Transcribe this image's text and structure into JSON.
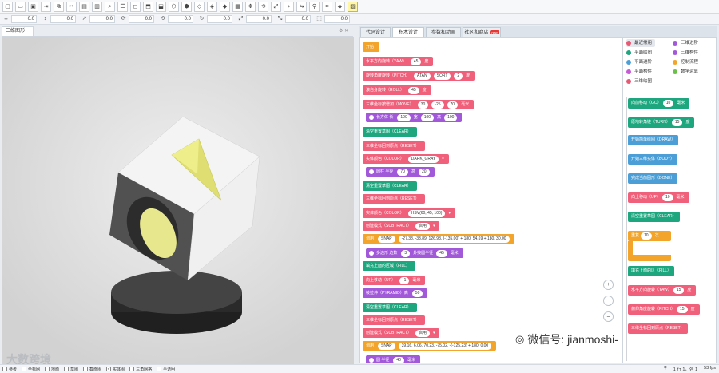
{
  "view": {
    "tab_label": "三维图形",
    "pin_icon": "pin-icon",
    "close_icon": "close-icon"
  },
  "fields": [
    {
      "icon": "move-x-icon",
      "glyph": "↔",
      "value": "0.0"
    },
    {
      "icon": "move-y-icon",
      "glyph": "↕",
      "value": "0.0"
    },
    {
      "icon": "move-z-icon",
      "glyph": "↗",
      "value": "0.0"
    },
    {
      "icon": "rotate-x-icon",
      "glyph": "⟳",
      "value": "0.0"
    },
    {
      "icon": "rotate-y-icon",
      "glyph": "⟲",
      "value": "0.0"
    },
    {
      "icon": "rotate-z-icon",
      "glyph": "↻",
      "value": "0.0"
    },
    {
      "icon": "scale-x-icon",
      "glyph": "⤢",
      "value": "0.0"
    },
    {
      "icon": "scale-y-icon",
      "glyph": "⤡",
      "value": "0.0"
    },
    {
      "icon": "scale-z-icon",
      "glyph": "⬚",
      "value": "0.0"
    }
  ],
  "tabs": [
    {
      "label": "代码设计",
      "active": false
    },
    {
      "label": "积木设计",
      "active": true
    },
    {
      "label": "参数和动画",
      "active": false
    },
    {
      "label": "社区和商店",
      "active": false,
      "badge": "new"
    }
  ],
  "blocks": {
    "start": "开始",
    "yaw": {
      "label": "水平方向旋转（YAW）",
      "value": "45",
      "unit": "度"
    },
    "pitch": {
      "label": "旋转角度旋转（PITCH）",
      "fn1": "ATAN",
      "fn2": "SQRT",
      "arg": "2",
      "unit": "度"
    },
    "roll": {
      "label": "滚自身旋转（ROLL）",
      "value": "45",
      "unit": "度"
    },
    "move": {
      "label": "三维坐标按增加（MOVE）",
      "x": "30",
      "y": "-25",
      "z": "70",
      "unit": "毫米"
    },
    "cuboid": {
      "label": "长方体 长",
      "l": "100",
      "w_label": "宽",
      "w": "100",
      "h_label": "高",
      "h": "100"
    },
    "clear1": "清空重置草图（CLEAR）",
    "reset1": "三维坐标回到原点（RESET）",
    "color1": {
      "label": "实体颜色（COLOR）",
      "value": "DARK_GRAY"
    },
    "cylinder": {
      "label": "圆柱 半径",
      "r": "70",
      "h_label": "高",
      "h": "20"
    },
    "clear2": "清空重置草图（CLEAR）",
    "reset2": "三维坐标回到原点（RESET）",
    "color2": {
      "label": "实体颜色（COLOR）",
      "value": "HSV(60, 45, 100)"
    },
    "subtract1": {
      "label": "创建模式（SUBTRACT）",
      "value": "启用"
    },
    "snap1": {
      "label": "调用",
      "fn": "SNAP",
      "args": "-27.38, -33.89, 126.93, (-135.00) + 180, 54.69 + 180, 30.00"
    },
    "polygon": {
      "label": "多边形 边数",
      "sides": "3",
      "r_label": "外接圆半径",
      "r": "45",
      "unit": "毫米"
    },
    "fill": "填充上面的区域（FILL）",
    "up": {
      "label": "向上移动（UP）",
      "value": "-1",
      "unit": "毫米"
    },
    "pyramid": {
      "label": "棱拉伸（PYRAMID）高",
      "value": "50"
    },
    "clear3": "清空重置草图（CLEAR）",
    "reset3": "三维坐标回到原点（RESET）",
    "subtract2": {
      "label": "创建模式（SUBTRACT）",
      "value": "启用"
    },
    "snap2": {
      "label": "调用",
      "fn": "SNAP",
      "args": "39.16, 6.06, 70.23, -75.02, -(-125.23) + 180, 0.00"
    },
    "circle": {
      "label": "圆 半径",
      "value": "40",
      "unit": "毫米"
    }
  },
  "categories": [
    {
      "label": "最近常用",
      "color": "#e85a74",
      "selected": true
    },
    {
      "label": "三维进阶",
      "color": "#a259d9"
    },
    {
      "label": "平面绘图",
      "color": "#1ea77f"
    },
    {
      "label": "三维构件",
      "color": "#a259d9"
    },
    {
      "label": "平面进阶",
      "color": "#4b9fd6"
    },
    {
      "label": "控制流程",
      "color": "#f2a52a"
    },
    {
      "label": "平面构件",
      "color": "#c75ad6"
    },
    {
      "label": "数学运算",
      "color": "#6cc04a"
    },
    {
      "label": "三维绘图",
      "color": "#e85a74"
    }
  ],
  "palette": {
    "go": {
      "label": "向前移动（GO）",
      "value": "10",
      "unit": "毫米"
    },
    "turn": {
      "label": "原地转角链（TURN）",
      "value": "15",
      "unit": "度"
    },
    "draw": "开始简单绘图（DRAW）",
    "body": "开始三维实体（BODY）",
    "done": "完成当前图形（DONE）",
    "up": {
      "label": "向上移动（UP）",
      "value": "10",
      "unit": "毫米"
    },
    "clear": "清空重置草图（CLEAR）",
    "repeat": {
      "label": "重复",
      "value": "10",
      "unit": "次"
    },
    "fill": "填充上面的区（FILL）",
    "yaw": {
      "label": "水平方向旋转（YAW）",
      "value": "15",
      "unit": "度"
    },
    "pitch": {
      "label": "俯仰角度旋转（PITCH）",
      "value": "15",
      "unit": "度"
    },
    "reset": "三维坐标回到原点（RESET）"
  },
  "zoom": {
    "in": "+",
    "out": "−",
    "reset": "="
  },
  "watermark": {
    "left": "大数跨境",
    "right": "微信号: jianmoshi-"
  },
  "status": {
    "options": [
      {
        "label": "参考",
        "checked": false
      },
      {
        "label": "坐标网",
        "checked": false
      },
      {
        "label": "地面",
        "checked": false
      },
      {
        "label": "草图",
        "checked": false
      },
      {
        "label": "截面图",
        "checked": false
      },
      {
        "label": "实体图",
        "checked": true
      },
      {
        "label": "三角网格",
        "checked": false
      },
      {
        "label": "半透明",
        "checked": false
      }
    ],
    "position": "1 行 1，列 1",
    "fps": "53 fps"
  },
  "colors": {
    "pink": "#f0607a",
    "purple": "#a259d9",
    "teal": "#1ea77f",
    "blue": "#4b9fd6",
    "orange": "#f2a52a",
    "magenta": "#c75ad6"
  }
}
